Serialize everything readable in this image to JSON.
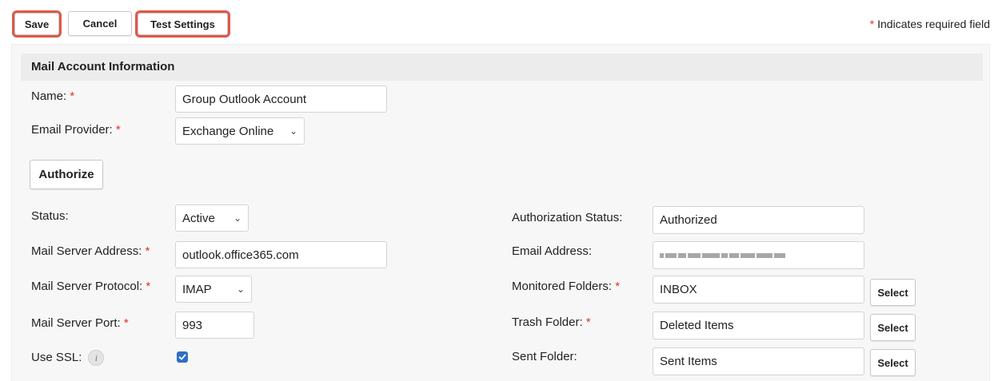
{
  "toolbar": {
    "save_label": "Save",
    "cancel_label": "Cancel",
    "test_settings_label": "Test Settings",
    "required_star": "*",
    "required_note": "Indicates required field"
  },
  "section": {
    "title": "Mail Account Information"
  },
  "form": {
    "name_label": "Name:",
    "name_value": "Group Outlook Account",
    "provider_label": "Email Provider:",
    "provider_value": "Exchange Online",
    "authorize_label": "Authorize",
    "status_label": "Status:",
    "status_value": "Active",
    "server_address_label": "Mail Server Address:",
    "server_address_value": "outlook.office365.com",
    "protocol_label": "Mail Server Protocol:",
    "protocol_value": "IMAP",
    "port_label": "Mail Server Port:",
    "port_value": "993",
    "ssl_label": "Use SSL:",
    "ssl_checked": true,
    "auth_status_label": "Authorization Status:",
    "auth_status_value": "Authorized",
    "email_label": "Email Address:",
    "email_value_obscured": true,
    "monitored_label": "Monitored Folders:",
    "monitored_value": "INBOX",
    "trash_label": "Trash Folder:",
    "trash_value": "Deleted Items",
    "sent_label": "Sent Folder:",
    "sent_value": "Sent Items",
    "select_label": "Select"
  },
  "colors": {
    "highlight": "#e0574a",
    "required": "#e0302a",
    "checkbox": "#2f6ec8"
  }
}
